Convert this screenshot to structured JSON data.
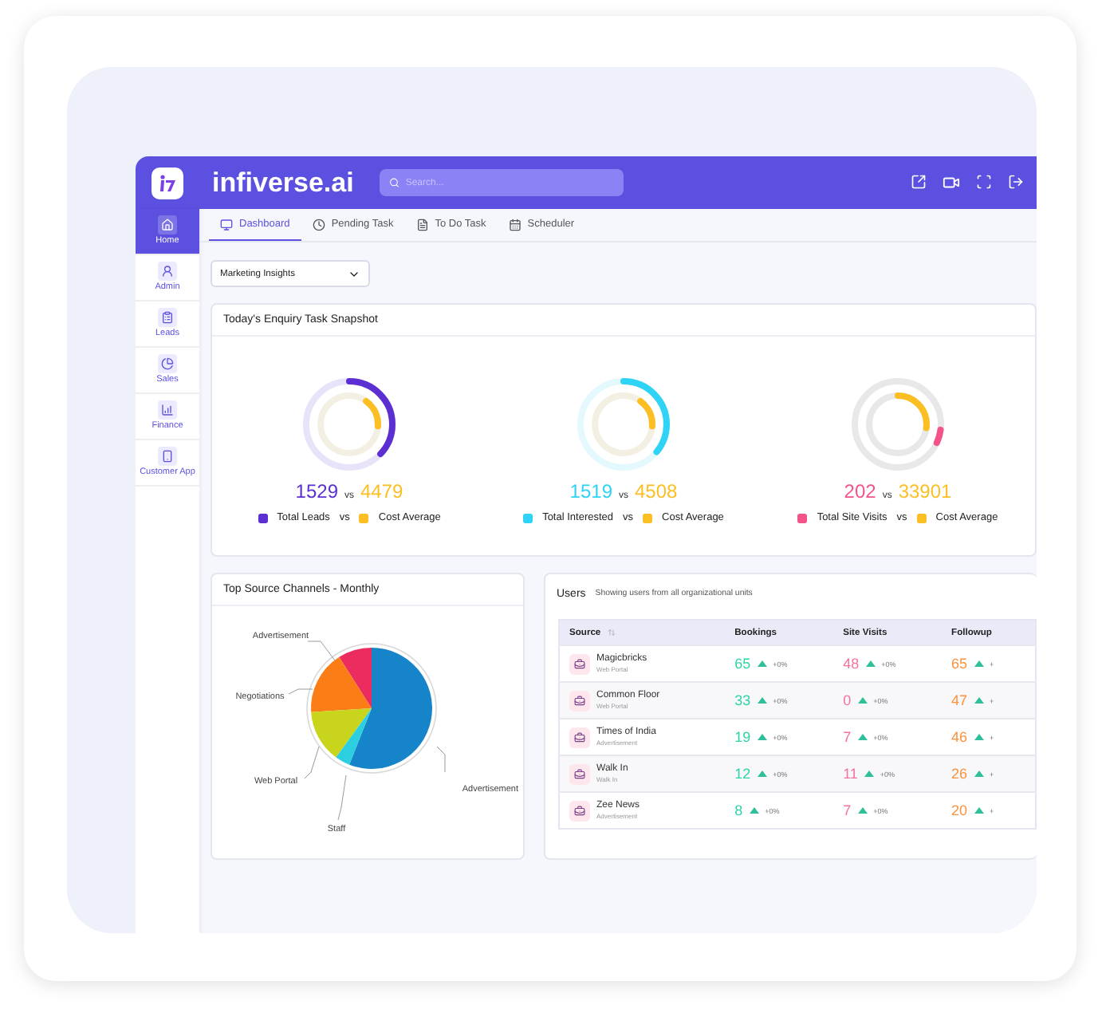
{
  "header": {
    "brand": "infiverse.ai",
    "search": {
      "placeholder": "Search..."
    }
  },
  "sidebar": {
    "items": [
      {
        "label": "Home",
        "selected": true
      },
      {
        "label": "Admin",
        "selected": false
      },
      {
        "label": "Leads",
        "selected": false
      },
      {
        "label": "Sales",
        "selected": false
      },
      {
        "label": "Finance",
        "selected": false
      },
      {
        "label": "Customer App",
        "selected": false
      }
    ]
  },
  "tabs": [
    {
      "label": "Dashboard",
      "selected": true
    },
    {
      "label": "Pending Task",
      "selected": false
    },
    {
      "label": "To Do Task",
      "selected": false
    },
    {
      "label": "Scheduler",
      "selected": false
    }
  ],
  "filter": {
    "value": "Marketing Insights"
  },
  "snapshot": {
    "title": "Today's Enquiry Task Snapshot",
    "gauges": [
      {
        "value": "1529",
        "vs": "vs",
        "label": "Total Leads",
        "legend_vs": "vs",
        "color": "#5b2fd1",
        "level": 0.37,
        "cost": {
          "value": "4479",
          "label": "Cost Average",
          "color": "#fbbf24",
          "level": 0.16
        }
      },
      {
        "value": "1519",
        "vs": "vs",
        "label": "Total Interested",
        "legend_vs": "vs",
        "color": "#2ed3f5",
        "level": 0.36,
        "cost": {
          "value": "4508",
          "label": "Cost Average",
          "color": "#fbbf24",
          "level": 0.16
        }
      },
      {
        "value": "202",
        "vs": "vs",
        "label": "Total Site Visits",
        "legend_vs": "vs",
        "color": "#f4528a",
        "level": 0.05,
        "cost": {
          "value": "33901",
          "label": "Cost Average",
          "color": "#fbbf24",
          "level": 0.27
        }
      }
    ]
  },
  "source_channels": {
    "title": "Top Source Channels - Monthly",
    "slices": [
      {
        "label": "Advertisement",
        "color": "#ec2c5e"
      },
      {
        "label": "Negotiations",
        "color": "#fb7d16"
      },
      {
        "label": "Web Portal",
        "color": "#c9d41c"
      },
      {
        "label": "Advertisement",
        "color": "#1584c8"
      },
      {
        "label": "Staff",
        "color": "#2ccfe0"
      }
    ]
  },
  "users": {
    "title": "Users",
    "subtitle": "Showing users from all organizational units",
    "columns": [
      {
        "label": "Source",
        "sortable": true
      },
      {
        "label": "Bookings",
        "sortable": false
      },
      {
        "label": "Site Visits",
        "sortable": false
      },
      {
        "label": "Followup",
        "sortable": false
      }
    ],
    "rows": [
      {
        "name": "Magicbricks",
        "channel": "Web Portal",
        "bookings": "65",
        "bookings_change": "+0%",
        "site_visits": "48",
        "site_visits_change": "+0%",
        "followups": "65",
        "followups_change": "+"
      },
      {
        "name": "Common Floor",
        "channel": "Web Portal",
        "bookings": "33",
        "bookings_change": "+0%",
        "site_visits": "0",
        "site_visits_change": "+0%",
        "followups": "47",
        "followups_change": "+"
      },
      {
        "name": "Times of India",
        "channel": "Advertisement",
        "bookings": "19",
        "bookings_change": "+0%",
        "site_visits": "7",
        "site_visits_change": "+0%",
        "followups": "46",
        "followups_change": "+"
      },
      {
        "name": "Walk In",
        "channel": "Walk In",
        "bookings": "12",
        "bookings_change": "+0%",
        "site_visits": "11",
        "site_visits_change": "+0%",
        "followups": "26",
        "followups_change": "+"
      },
      {
        "name": "Zee News",
        "channel": "Advertisement",
        "bookings": "8",
        "bookings_change": "+0%",
        "site_visits": "7",
        "site_visits_change": "+0%",
        "followups": "20",
        "followups_change": "+"
      }
    ]
  }
}
